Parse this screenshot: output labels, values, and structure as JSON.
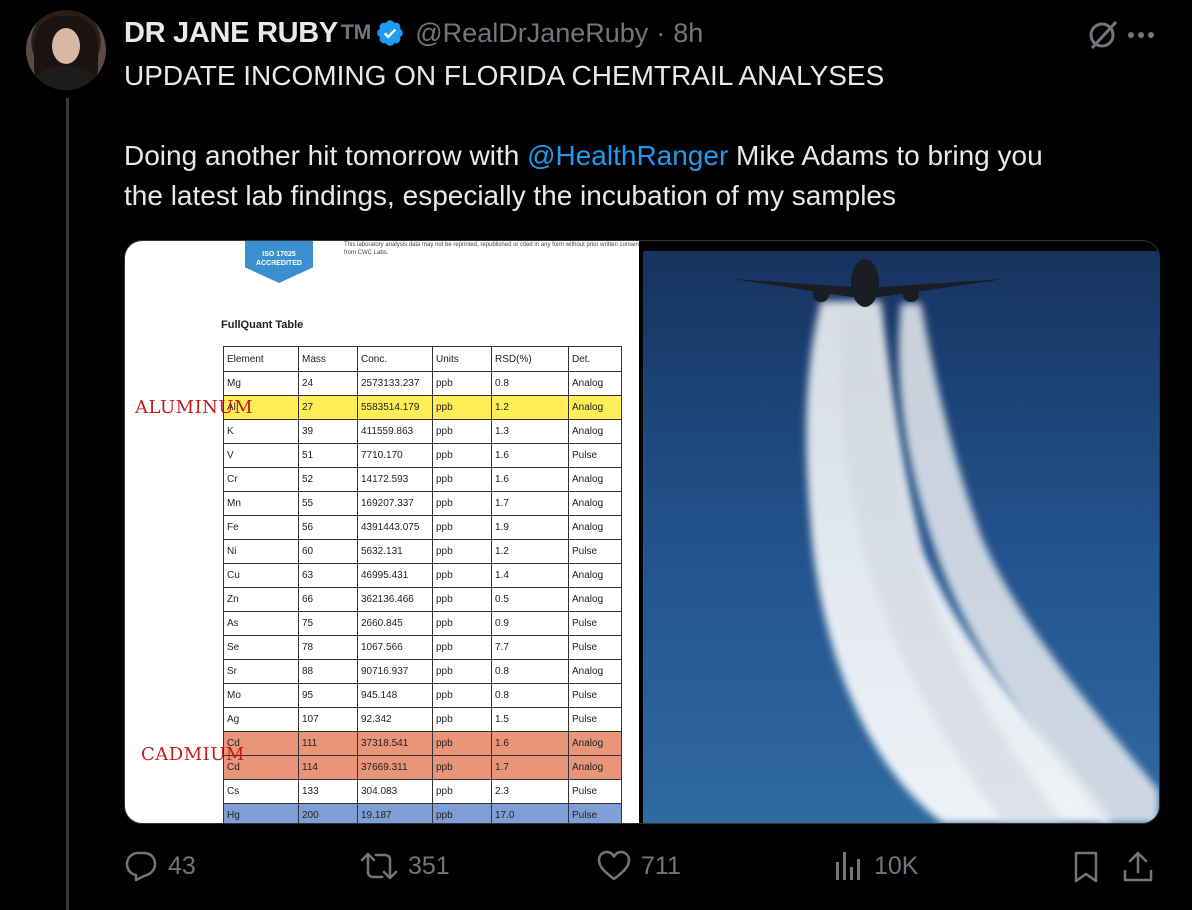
{
  "tweet": {
    "display_name": "DR JANE RUBY",
    "tm": "TM",
    "handle": "@RealDrJaneRuby",
    "separator": "·",
    "time": "8h",
    "line1": "UPDATE INCOMING ON FLORIDA CHEMTRAIL ANALYSES",
    "line2_before": "Doing another hit tomorrow with ",
    "line2_mention": "@HealthRanger",
    "line2_after": " Mike Adams to bring you",
    "line3": "the latest lab findings, especially the incubation of my samples"
  },
  "media": {
    "doc": {
      "badge": "ACCREDITED",
      "badge_top": "ISO 17025",
      "disclaimer": "This laboratory analysis data may not be reprinted, republished or cited in any form without prior written consent from CWC Labs.",
      "table_title": "FullQuant Table",
      "headers": [
        "Element",
        "Mass",
        "Conc.",
        "Units",
        "RSD(%)",
        "Det."
      ],
      "rows": [
        [
          "Mg",
          "24",
          "2573133.237",
          "ppb",
          "0.8",
          "Analog"
        ],
        [
          "Al",
          "27",
          "5583514.179",
          "ppb",
          "1.2",
          "Analog"
        ],
        [
          "K",
          "39",
          "411559.863",
          "ppb",
          "1.3",
          "Analog"
        ],
        [
          "V",
          "51",
          "7710.170",
          "ppb",
          "1.6",
          "Pulse"
        ],
        [
          "Cr",
          "52",
          "14172.593",
          "ppb",
          "1.6",
          "Analog"
        ],
        [
          "Mn",
          "55",
          "169207.337",
          "ppb",
          "1.7",
          "Analog"
        ],
        [
          "Fe",
          "56",
          "4391443.075",
          "ppb",
          "1.9",
          "Analog"
        ],
        [
          "Ni",
          "60",
          "5632.131",
          "ppb",
          "1.2",
          "Pulse"
        ],
        [
          "Cu",
          "63",
          "46995.431",
          "ppb",
          "1.4",
          "Analog"
        ],
        [
          "Zn",
          "66",
          "362136.466",
          "ppb",
          "0.5",
          "Analog"
        ],
        [
          "As",
          "75",
          "2660.845",
          "ppb",
          "0.9",
          "Pulse"
        ],
        [
          "Se",
          "78",
          "1067.566",
          "ppb",
          "7.7",
          "Pulse"
        ],
        [
          "Sr",
          "88",
          "90716.937",
          "ppb",
          "0.8",
          "Analog"
        ],
        [
          "Mo",
          "95",
          "945.148",
          "ppb",
          "0.8",
          "Pulse"
        ],
        [
          "Ag",
          "107",
          "92.342",
          "ppb",
          "1.5",
          "Pulse"
        ],
        [
          "Cd",
          "111",
          "37318.541",
          "ppb",
          "1.6",
          "Analog"
        ],
        [
          "Cd",
          "114",
          "37669.311",
          "ppb",
          "1.7",
          "Analog"
        ],
        [
          "Cs",
          "133",
          "304.083",
          "ppb",
          "2.3",
          "Pulse"
        ],
        [
          "Hg",
          "200",
          "19.187",
          "ppb",
          "17.0",
          "Pulse"
        ]
      ],
      "row_highlights": [
        "",
        "yellow",
        "",
        "",
        "",
        "",
        "",
        "",
        "",
        "",
        "",
        "",
        "",
        "",
        "",
        "salmon",
        "salmon",
        "",
        "blue"
      ],
      "annotation_aluminum": "ALUMINUM",
      "annotation_cadmium": "CADMIUM"
    }
  },
  "actions": {
    "replies": "43",
    "retweets": "351",
    "likes": "711",
    "views": "10K"
  },
  "colors": {
    "background": "#000000",
    "text": "#e7e9ea",
    "muted": "#71767b",
    "accent": "#1d9bf0"
  },
  "icons": [
    "verified-badge-icon",
    "grok-icon",
    "more-icon",
    "reply-icon",
    "retweet-icon",
    "like-icon",
    "views-icon",
    "bookmark-icon",
    "share-icon"
  ]
}
